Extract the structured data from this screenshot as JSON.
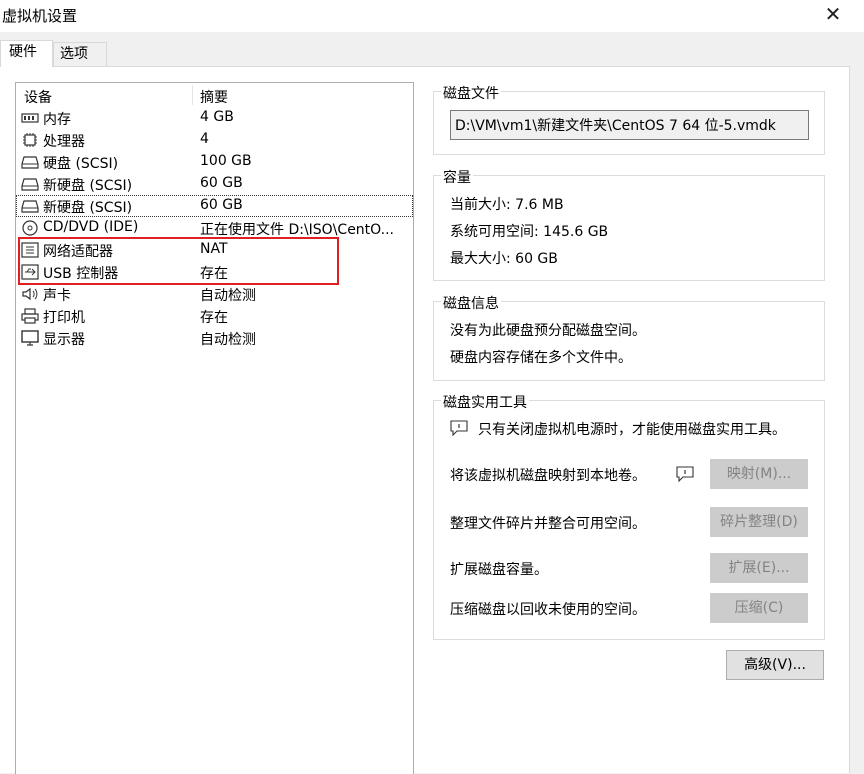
{
  "window": {
    "title": "虚拟机设置"
  },
  "tabs": [
    {
      "label": "硬件",
      "active": true
    },
    {
      "label": "选项",
      "active": false
    }
  ],
  "device_list": {
    "columns": [
      "设备",
      "摘要"
    ],
    "rows": [
      {
        "icon": "memory-icon",
        "name": "内存",
        "summary": "4 GB"
      },
      {
        "icon": "cpu-icon",
        "name": "处理器",
        "summary": "4"
      },
      {
        "icon": "disk-icon",
        "name": "硬盘 (SCSI)",
        "summary": "100 GB"
      },
      {
        "icon": "disk-icon",
        "name": "新硬盘 (SCSI)",
        "summary": "60 GB"
      },
      {
        "icon": "disk-icon",
        "name": "新硬盘 (SCSI)",
        "summary": "60 GB",
        "selected": true
      },
      {
        "icon": "cd-icon",
        "name": "CD/DVD (IDE)",
        "summary": "正在使用文件 D:\\ISO\\CentO..."
      },
      {
        "icon": "network-icon",
        "name": "网络适配器",
        "summary": "NAT"
      },
      {
        "icon": "usb-icon",
        "name": "USB 控制器",
        "summary": "存在"
      },
      {
        "icon": "sound-icon",
        "name": "声卡",
        "summary": "自动检测"
      },
      {
        "icon": "printer-icon",
        "name": "打印机",
        "summary": "存在"
      },
      {
        "icon": "display-icon",
        "name": "显示器",
        "summary": "自动检测"
      }
    ]
  },
  "disk_file": {
    "title": "磁盘文件",
    "path": "D:\\VM\\vm1\\新建文件夹\\CentOS 7 64 位-5.vmdk"
  },
  "capacity": {
    "title": "容量",
    "current": "当前大小: 7.6 MB",
    "available": "系统可用空间: 145.6 GB",
    "max": "最大大小: 60 GB"
  },
  "disk_info": {
    "title": "磁盘信息",
    "line1": "没有为此硬盘预分配磁盘空间。",
    "line2": "硬盘内容存储在多个文件中。"
  },
  "disk_utilities": {
    "title": "磁盘实用工具",
    "notice": "只有关闭虚拟机电源时，才能使用磁盘实用工具。",
    "map_desc": "将该虚拟机磁盘映射到本地卷。",
    "map_btn": "映射(M)...",
    "defrag_desc": "整理文件碎片并整合可用空间。",
    "defrag_btn": "碎片整理(D)",
    "expand_desc": "扩展磁盘容量。",
    "expand_btn": "扩展(E)...",
    "compact_desc": "压缩磁盘以回收未使用的空间。",
    "compact_btn": "压缩(C)"
  },
  "advanced_btn": "高级(V)...",
  "colors": {
    "highlight": "#e02020",
    "disabled_button": "#cccccc"
  }
}
